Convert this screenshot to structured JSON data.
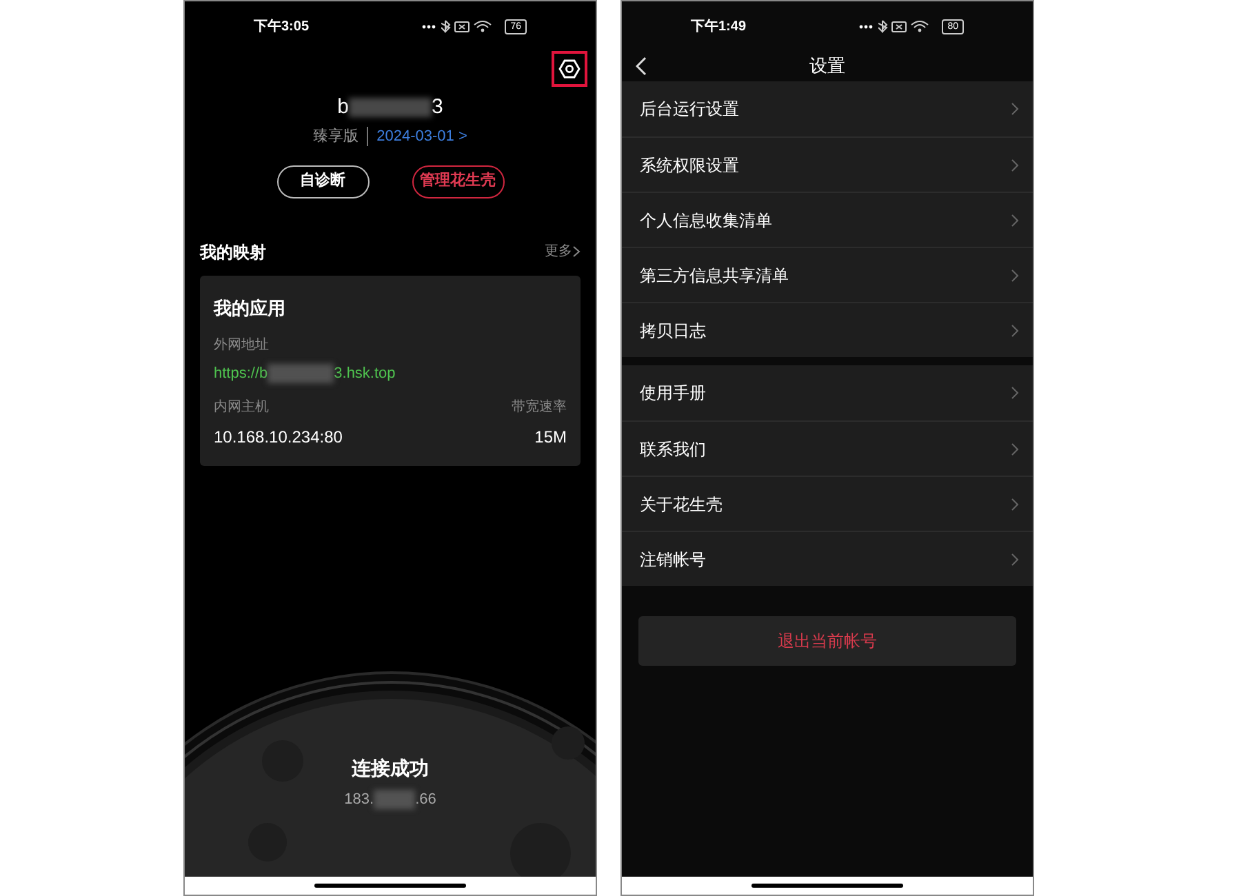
{
  "home_screen": {
    "status_bar": {
      "time": "下午3:05",
      "battery": "76"
    },
    "settings_button": {
      "highlighted": true
    },
    "account": {
      "name_start": "b",
      "name_end": "3",
      "edition": "臻享版",
      "expiry": "2024-03-01 >"
    },
    "actions": [
      {
        "label": "自诊断",
        "kind": "plain"
      },
      {
        "label": "管理花生壳",
        "kind": "accent"
      }
    ],
    "mappings": {
      "title": "我的映射",
      "more": "更多",
      "card": {
        "title": "我的应用",
        "external_label": "外网地址",
        "url_start": "https://b",
        "url_end": "3.hsk.top",
        "internal_label": "内网主机",
        "internal_host": "10.168.10.234:80",
        "bandwidth_label": "带宽速率",
        "bandwidth": "15M"
      }
    },
    "connection": {
      "status": "连接成功",
      "ip_start": "183.",
      "ip_end": ".66"
    }
  },
  "settings_screen": {
    "status_bar": {
      "time": "下午1:49",
      "battery": "80"
    },
    "title": "设置",
    "groups": [
      [
        "后台运行设置",
        "系统权限设置",
        "个人信息收集清单",
        "第三方信息共享清单",
        "拷贝日志"
      ],
      [
        "使用手册",
        "联系我们",
        "关于花生壳",
        "注销帐号"
      ]
    ],
    "logout": "退出当前帐号"
  }
}
